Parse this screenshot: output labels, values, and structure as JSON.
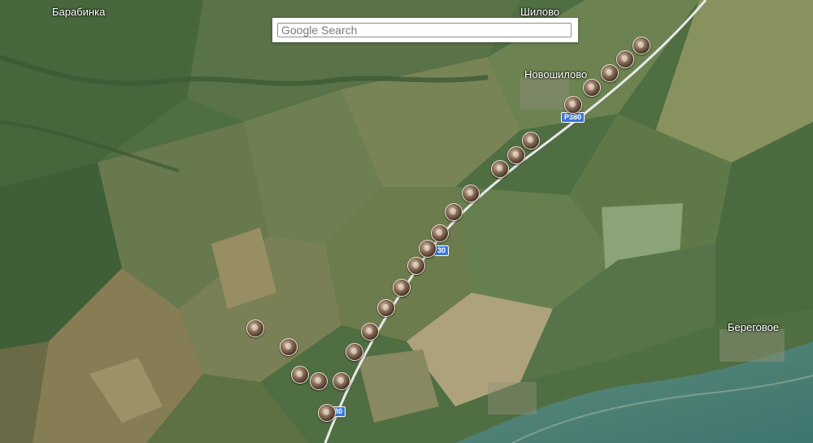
{
  "search": {
    "placeholder": "Google Search"
  },
  "places": {
    "barabinka": "Барабинка",
    "shilovo": "Шилово",
    "novoshilovo": "Новошилово",
    "beregovoe": "Береговое"
  },
  "roads": {
    "shield_top": "Р380",
    "shield_mid": "30",
    "shield_bottom": "30"
  },
  "markers_count_label": "",
  "colors": {
    "road_shield": "#3b77d8",
    "water": "#3f7a72"
  }
}
